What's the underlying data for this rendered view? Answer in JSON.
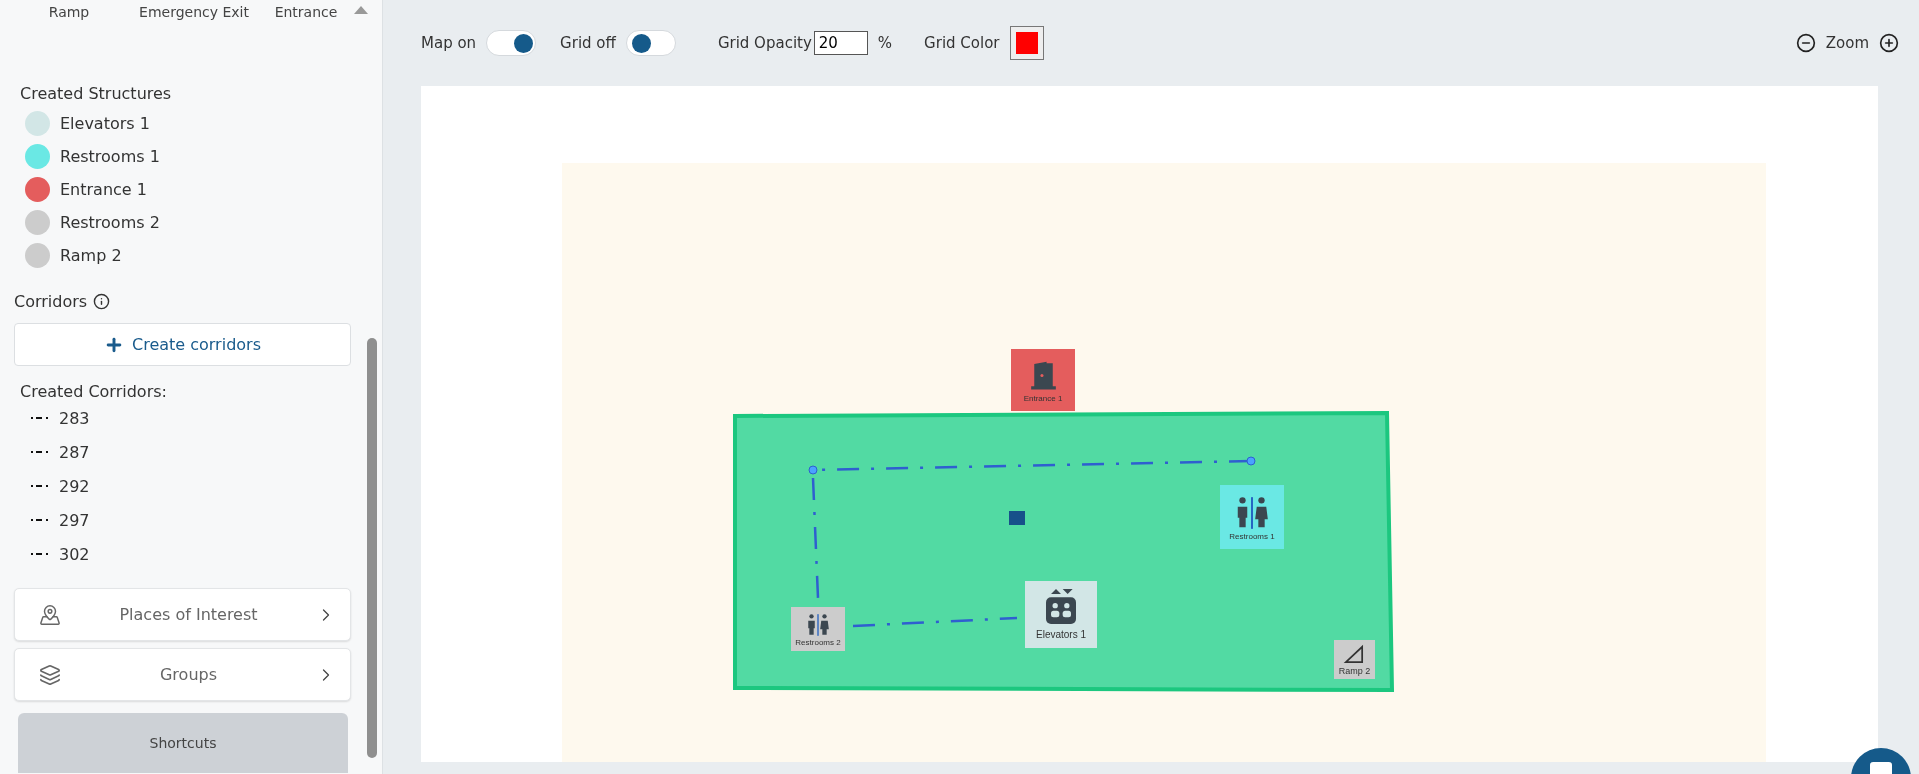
{
  "structure_types": [
    "Ramp",
    "Emergency Exit",
    "Entrance"
  ],
  "created_structures": {
    "title": "Created Structures",
    "items": [
      {
        "label": "Elevators 1",
        "color": "#d2e6e6"
      },
      {
        "label": "Restrooms 1",
        "color": "#6ae8e4"
      },
      {
        "label": "Entrance 1",
        "color": "#e45d5d"
      },
      {
        "label": "Restrooms 2",
        "color": "#cccccc"
      },
      {
        "label": "Ramp 2",
        "color": "#cccccc"
      }
    ]
  },
  "corridors": {
    "title": "Corridors",
    "create_button": "Create corridors",
    "created_title": "Created Corridors:",
    "items": [
      "283",
      "287",
      "292",
      "297",
      "302"
    ]
  },
  "sections": [
    {
      "kind": "places",
      "label": "Places of Interest"
    },
    {
      "kind": "groups",
      "label": "Groups"
    }
  ],
  "shortcuts_button": "Shortcuts",
  "toolbar": {
    "toggles": [
      {
        "label": "Map on",
        "on": true
      },
      {
        "label": "Grid off",
        "on": false
      }
    ],
    "grid_opacity": {
      "label": "Grid Opacity",
      "value": "20",
      "unit": "%"
    },
    "grid_color": {
      "label": "Grid Color",
      "color": "#ff0000"
    },
    "zoom": {
      "label": "Zoom"
    }
  },
  "map": {
    "markers": [
      {
        "kind": "entrance",
        "label": "Entrance 1",
        "color": "#e45d5d"
      },
      {
        "kind": "restroom",
        "label": "Restrooms 1",
        "color": "#6ae8e4"
      },
      {
        "kind": "restroom",
        "label": "Restrooms 2",
        "color": "#cccccc"
      },
      {
        "kind": "elevator",
        "label": "Elevators 1",
        "color": "#d2e6e6"
      },
      {
        "kind": "ramp",
        "label": "Ramp 2",
        "color": "#cccccc"
      }
    ]
  }
}
